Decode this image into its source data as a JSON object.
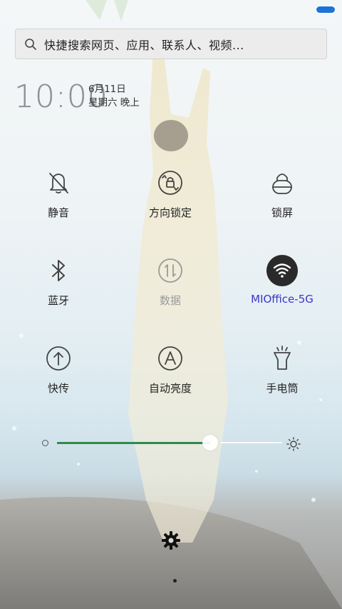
{
  "search": {
    "placeholder": "快捷搜索网页、应用、联系人、视频..."
  },
  "clock": {
    "time": "10:00",
    "date": "6月11日",
    "weekday": "星期六 晚上"
  },
  "tiles": [
    {
      "label": "静音",
      "icon": "bell-off-icon"
    },
    {
      "label": "方向锁定",
      "icon": "rotation-lock-icon"
    },
    {
      "label": "锁屏",
      "icon": "lock-icon"
    },
    {
      "label": "蓝牙",
      "icon": "bluetooth-icon"
    },
    {
      "label": "数据",
      "icon": "mobile-data-icon",
      "state": "disabled"
    },
    {
      "label": "MIOffice-5G",
      "icon": "wifi-icon",
      "state": "active"
    },
    {
      "label": "快传",
      "icon": "quick-transfer-icon"
    },
    {
      "label": "自动亮度",
      "icon": "auto-brightness-icon"
    },
    {
      "label": "手电筒",
      "icon": "flashlight-icon"
    }
  ],
  "brightness": {
    "level": 0.68
  },
  "colors": {
    "accent": "#3a36c8",
    "slider": "#2e8b4a",
    "battery": "#1e73d8"
  }
}
